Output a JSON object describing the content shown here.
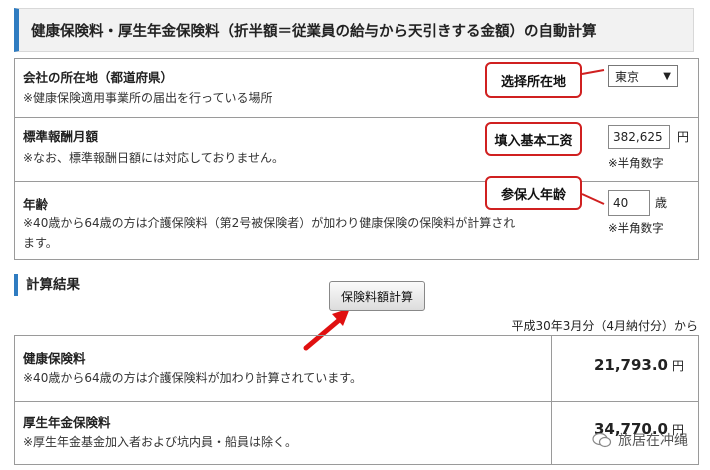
{
  "title": "健康保険料・厚生年金保険料（折半額＝従業員の給与から天引きする金額）の自動計算",
  "form": {
    "prefecture": {
      "label": "会社の所在地（都道府県）",
      "note": "※健康保険適用事業所の届出を行っている場所",
      "selected": "東京",
      "callout": "选择所在地"
    },
    "salary": {
      "label": "標準報酬月額",
      "note": "※なお、標準報酬日額には対応しておりません。",
      "value": "382,625",
      "unit": "円",
      "hint": "※半角数字",
      "callout": "填入基本工资"
    },
    "age": {
      "label": "年齢",
      "note_line1": "※40歳から64歳の方は介護保険料（第2号被保険者）が加わり健康保険の保険料が計算され",
      "note_line2": "ます。",
      "value": "40",
      "unit": "歳",
      "hint": "※半角数字",
      "callout": "参保人年龄"
    }
  },
  "results_section": {
    "title": "計算結果",
    "button": "保険料額計算",
    "period": "平成30年3月分（4月納付分）から",
    "rows": [
      {
        "label": "健康保険料",
        "note": "※40歳から64歳の方は介護保険料が加わり計算されています。",
        "amount": "21,793.0",
        "unit": "円"
      },
      {
        "label": "厚生年金保険料",
        "note": "※厚生年金基金加入者および坑内員・船員は除く。",
        "amount": "34,770.0",
        "unit": "円"
      }
    ]
  },
  "watermark": "旅居在冲绳",
  "colors": {
    "accent": "#2f7cc1",
    "callout_border": "#d02020",
    "arrow": "#e01010"
  }
}
